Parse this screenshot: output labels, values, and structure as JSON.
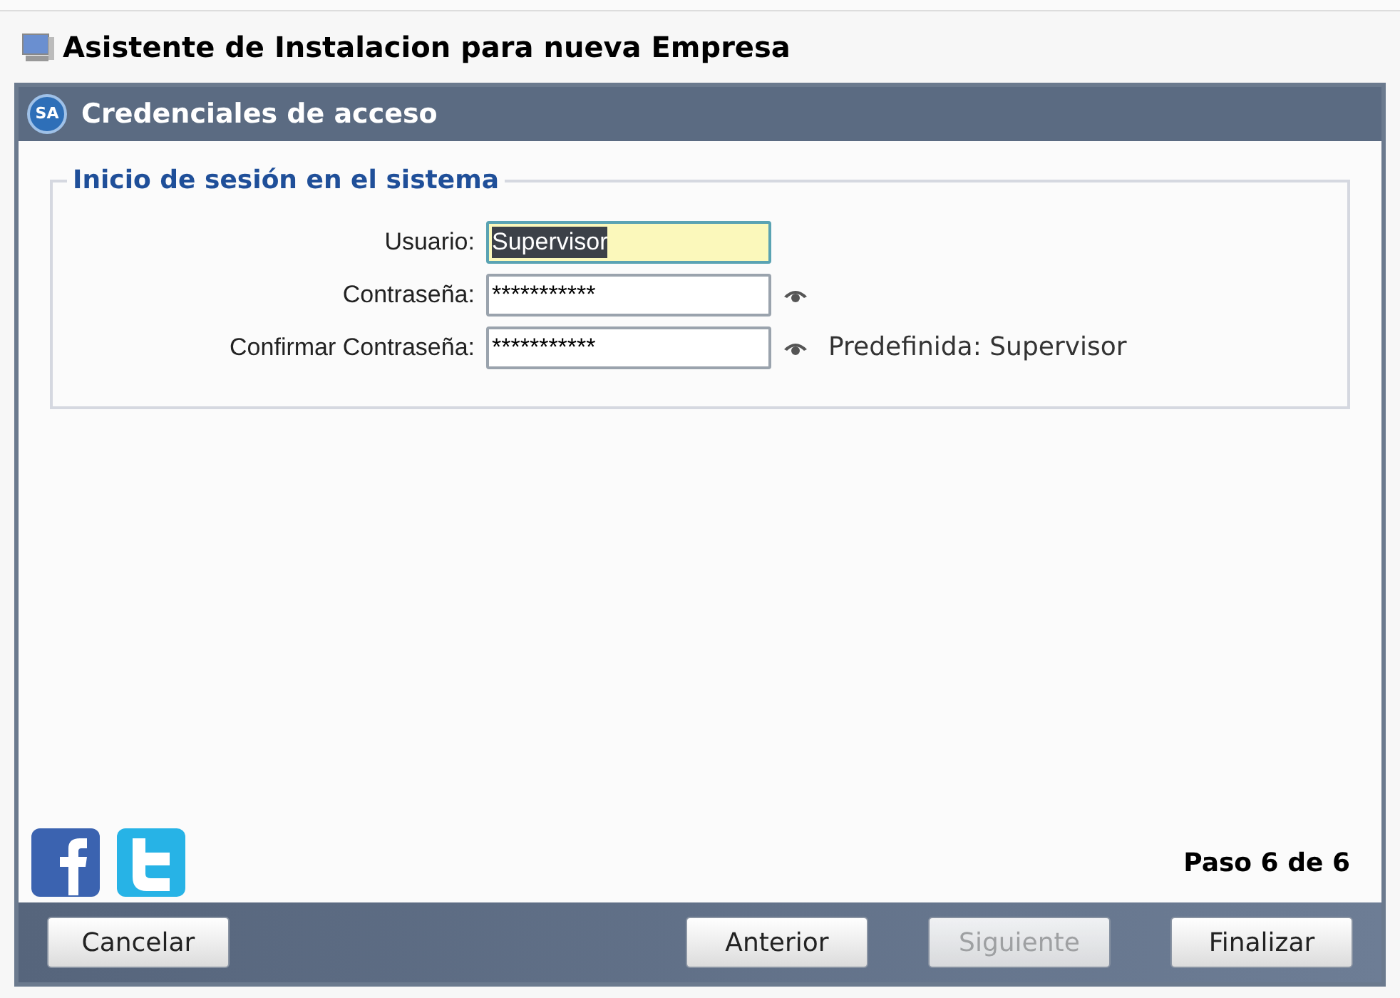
{
  "window": {
    "title": "Asistente de Instalacion para nueva Empresa"
  },
  "panel": {
    "logo": "SA",
    "title": "Credenciales de acceso"
  },
  "group": {
    "legend": "Inicio de sesión en el sistema",
    "fields": [
      {
        "label": "Usuario:",
        "value": "Supervisor",
        "kind": "text",
        "focused": true,
        "selected": true
      },
      {
        "label": "Contraseña:",
        "value": "***********",
        "kind": "password",
        "focused": false,
        "selected": false
      },
      {
        "label": "Confirmar Contraseña:",
        "value": "***********",
        "kind": "password",
        "focused": false,
        "selected": false,
        "note": "Predefinida: Supervisor"
      }
    ]
  },
  "step": "Paso 6 de 6",
  "buttons": [
    {
      "label": "Cancelar",
      "disabled": false
    },
    {
      "label": "Anterior",
      "disabled": false
    },
    {
      "label": "Siguiente",
      "disabled": true
    },
    {
      "label": "Finalizar",
      "disabled": false
    }
  ]
}
